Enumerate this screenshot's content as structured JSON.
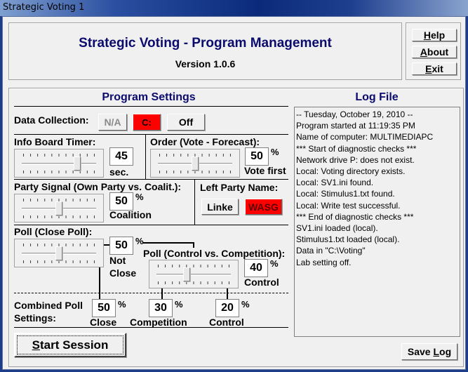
{
  "window": {
    "title": "Strategic Voting 1"
  },
  "header": {
    "title": "Strategic Voting - Program Management",
    "version": "Version 1.0.6",
    "title_color": "#0b0b6e"
  },
  "top_buttons": {
    "help": {
      "pre": "",
      "accel": "H",
      "post": "elp"
    },
    "about": {
      "pre": "",
      "accel": "A",
      "post": "bout"
    },
    "exit": {
      "pre": "",
      "accel": "E",
      "post": "xit"
    }
  },
  "settings": {
    "heading": "Program Settings",
    "data_collection": {
      "label": "Data Collection:",
      "buttons": [
        {
          "label": "N/A",
          "state": "disabled"
        },
        {
          "label": "C:",
          "state": "selected",
          "color": "#ff0000"
        },
        {
          "label": "Off",
          "state": "normal"
        }
      ]
    },
    "info_board_timer": {
      "label": "Info Board Timer:",
      "value": "45",
      "unit": "sec.",
      "slider_fraction": 0.75
    },
    "order": {
      "label": "Order (Vote - Forecast):",
      "value": "50",
      "percent": "%",
      "caption": "Vote first",
      "slider_fraction": 0.5
    },
    "party_signal": {
      "label": "Party Signal (Own Party vs. Coalit.):",
      "value": "50",
      "percent": "%",
      "caption": "Coalition",
      "slider_fraction": 0.5
    },
    "left_party_name": {
      "label": "Left Party Name:",
      "buttons": [
        {
          "label": "Linke",
          "state": "normal"
        },
        {
          "label": "WASG",
          "state": "selected",
          "color": "#ff0000"
        }
      ]
    },
    "poll_close": {
      "label": "Poll (Close Poll):",
      "value": "50",
      "percent": "%",
      "caption_line1": "Not",
      "caption_line2": "Close",
      "slider_fraction": 0.5
    },
    "poll_control": {
      "label": "Poll (Control vs. Competition):",
      "value": "40",
      "percent": "%",
      "caption": "Control",
      "slider_fraction": 0.4
    },
    "combined": {
      "label_line1": "Combined Poll",
      "label_line2": "Settings:",
      "items": [
        {
          "value": "50",
          "percent": "%",
          "caption": "Close"
        },
        {
          "value": "30",
          "percent": "%",
          "caption": "Competition"
        },
        {
          "value": "20",
          "percent": "%",
          "caption": "Control"
        }
      ]
    },
    "start_session": {
      "pre": "",
      "accel": "S",
      "post": "tart Session"
    }
  },
  "log": {
    "heading": "Log File",
    "lines": [
      "-- Tuesday, October 19, 2010 --",
      "Program started at 11:19:35 PM",
      "Name of computer: MULTIMEDIAPC",
      "*** Start of diagnostic checks ***",
      "Network drive P: does not exist.",
      "Local: Voting directory exists.",
      "Local: SV1.ini found.",
      "Local: Stimulus1.txt found.",
      "Local: Write test successful.",
      "*** End of diagnostic checks ***",
      "SV1.ini loaded (local).",
      "Stimulus1.txt loaded (local).",
      "Data in \"C:\\Voting\"",
      "Lab setting off."
    ],
    "save_button": {
      "pre": "Save ",
      "accel": "L",
      "post": "og"
    }
  }
}
